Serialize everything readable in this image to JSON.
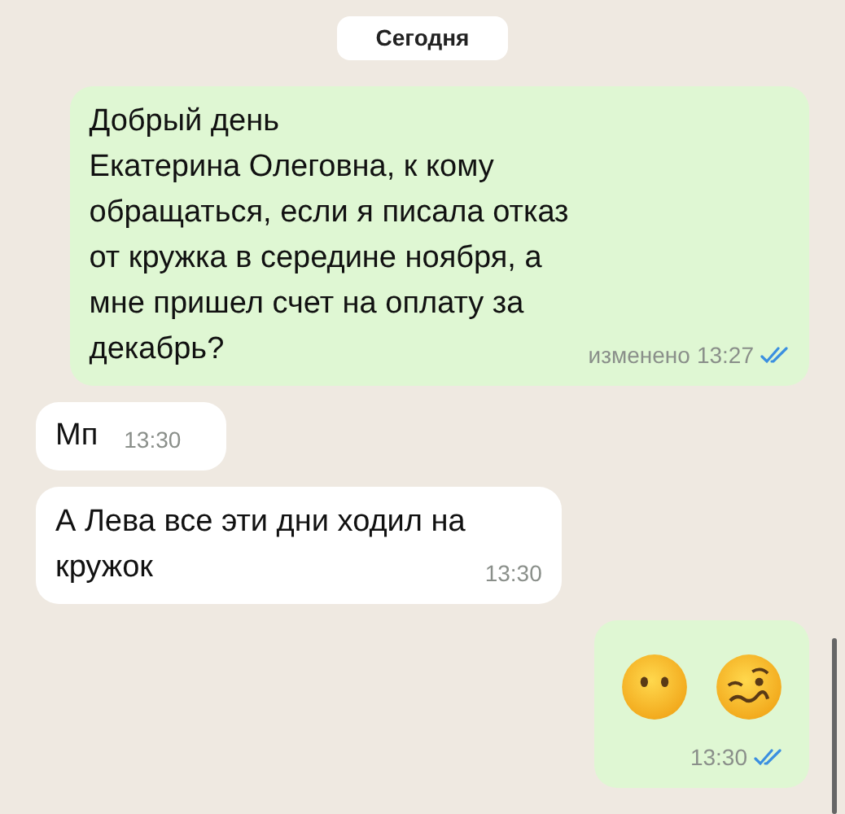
{
  "date_divider": "Сегодня",
  "messages": [
    {
      "kind": "text",
      "outgoing": true,
      "lines": [
        "Добрый день",
        "Екатерина Олеговна, к кому",
        "обращаться, если я писала отказ",
        "от кружка в середине ноября, а",
        "мне пришел счет на оплату за",
        "декабрь?"
      ],
      "edited_label": "изменено",
      "time": "13:27",
      "read": true
    },
    {
      "kind": "short",
      "outgoing": false,
      "lines": [
        "Мп"
      ],
      "time": "13:30"
    },
    {
      "kind": "text",
      "outgoing": false,
      "lines": [
        "А Лева все эти дни ходил на",
        "кружок"
      ],
      "time": "13:30"
    },
    {
      "kind": "emoji",
      "outgoing": true,
      "emoji": [
        {
          "kind": "no-mouth"
        },
        {
          "kind": "woozy"
        }
      ],
      "time": "13:30",
      "read": true
    }
  ]
}
